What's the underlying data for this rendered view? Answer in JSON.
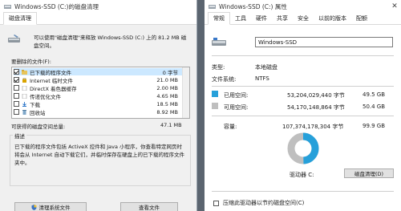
{
  "cleanup": {
    "title": "Windows-SSD (C:)的磁盘清理",
    "tab": "磁盘清理",
    "intro": "可以使用\"磁盘清理\"来释放 Windows-SSD (C:) 上的 81.2 MB 磁盘空间。",
    "files_label": "要删除的文件(F):",
    "items": [
      {
        "name": "已下载的程序文件",
        "size": "0 字节",
        "checked": true
      },
      {
        "name": "Internet 临时文件",
        "size": "21.0 MB",
        "checked": true
      },
      {
        "name": "DirectX 着色器缓存",
        "size": "2.00 MB",
        "checked": false
      },
      {
        "name": "传递优化文件",
        "size": "4.65 MB",
        "checked": false
      },
      {
        "name": "下载",
        "size": "18.5 MB",
        "checked": false
      },
      {
        "name": "回收站",
        "size": "8.92 MB",
        "checked": false
      }
    ],
    "total_label": "可获得的磁盘空间总量:",
    "total_value": "47.1 MB",
    "desc_label": "描述",
    "desc_text": "已下载的程序文件包括 ActiveX 控件和 Java 小程序，你查看特定网页时将会从 Internet 自动下载它们，并临时保存在硬盘上的已下载的程序文件夹中。",
    "btn_system": "清理系统文件",
    "btn_view": "查看文件"
  },
  "props": {
    "title": "Windows-SSD (C:) 属性",
    "tabs": [
      "常规",
      "工具",
      "硬件",
      "共享",
      "安全",
      "以前的版本",
      "配额"
    ],
    "drive_name": "Windows-SSD",
    "type_label": "类型:",
    "type_value": "本地磁盘",
    "fs_label": "文件系统:",
    "fs_value": "NTFS",
    "used_label": "已用空间:",
    "used_bytes": "53,204,029,440 字节",
    "used_gb": "49.5 GB",
    "free_label": "可用空间:",
    "free_bytes": "54,170,148,864 字节",
    "free_gb": "50.4 GB",
    "cap_label": "容量:",
    "cap_bytes": "107,374,178,304 字节",
    "cap_gb": "99.9 GB",
    "drive_label": "驱动器 C:",
    "btn_cleanup": "磁盘清理(D)",
    "compress_label": "压缩此驱动器以节约磁盘空间(C)",
    "used_fraction": 0.495,
    "colors": {
      "used": "#26a0da",
      "free": "#bfbfbf"
    }
  }
}
